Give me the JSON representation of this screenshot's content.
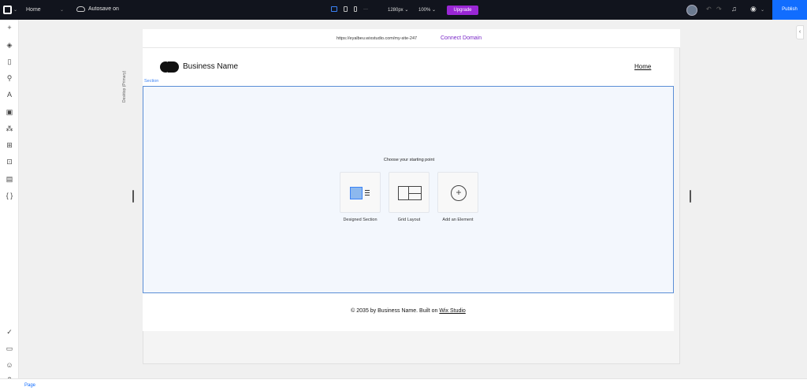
{
  "topbar": {
    "page_name": "Home",
    "page_caret": "⌄",
    "autosave": "Autosave on",
    "device_more": "···",
    "width": "1280px ⌄",
    "zoom": "100% ⌄",
    "upgrade": "Upgrade",
    "publish": "Publish"
  },
  "editor": {
    "breakpoint": "Desktop (Primary)",
    "section_label": "Section",
    "right_toggle": "‹"
  },
  "site": {
    "url": "https://eyalbeu.wixstudio.com/my-site-247",
    "connect_domain": "Connect Domain",
    "brand_name": "Business Name",
    "nav_home": "Home",
    "choose_title": "Choose your starting point",
    "options": [
      {
        "label": "Designed Section"
      },
      {
        "label": "Grid Layout"
      },
      {
        "label": "Add an Element"
      }
    ],
    "footer_prefix": "© 2035 by Business Name. Built on ",
    "footer_link": "Wix Studio"
  },
  "bottombar": {
    "page_label": "Page"
  },
  "colors": {
    "topbar_bg": "#11141d",
    "upgrade": "#9a27d5",
    "publish": "#116dff",
    "connect_domain": "#7a28c8",
    "selection": "#3b82f6"
  }
}
